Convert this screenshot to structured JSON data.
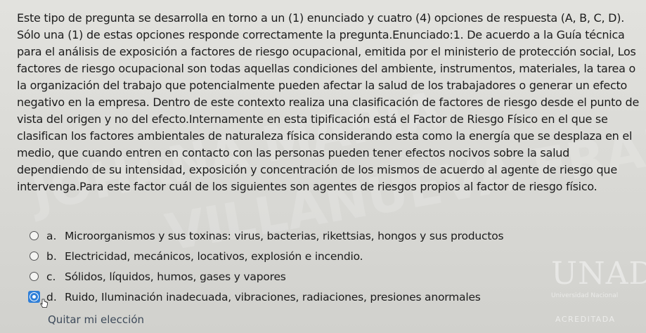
{
  "question": {
    "text": "Este tipo de pregunta se desarrolla en torno a un (1) enunciado y cuatro (4) opciones de respuesta (A, B, C, D). Sólo una (1) de estas opciones responde correctamente la pregunta.Enunciado:1. De acuerdo a la Guía técnica para el análisis de exposición a factores de riesgo ocupacional, emitida por el ministerio de protección social, Los factores de riesgo ocupacional son todas aquellas condiciones del ambiente, instrumentos, materiales, la tarea o la organización del trabajo que potencialmente pueden afectar la salud de los trabajadores o generar un efecto negativo en la empresa. Dentro de este contexto realiza una clasificación de factores de riesgo desde el punto de vista del origen y no del efecto.Internamente en esta tipificación está el Factor de Riesgo Físico en el que se clasifican los factores ambientales de naturaleza física considerando esta como la energía que se desplaza en el medio, que cuando entren en contacto con las personas pueden tener efectos nocivos sobre la salud dependiendo de su intensidad, exposición y concentración de los mismos de acuerdo al agente de riesgo que intervenga.Para este factor cuál de los siguientes son agentes de riesgos propios al factor de riesgo físico."
  },
  "options": [
    {
      "letter": "a.",
      "text": "Microorganismos y sus toxinas: virus, bacterias, rikettsias, hongos y sus productos",
      "selected": false
    },
    {
      "letter": "b.",
      "text": "Electricidad, mecánicos, locativos, explosión e incendio.",
      "selected": false
    },
    {
      "letter": "c.",
      "text": "Sólidos, líquidos, humos, gases y vapores",
      "selected": false
    },
    {
      "letter": "d.",
      "text": "Ruido, Iluminación inadecuada, vibraciones, radiaciones, presiones anormales",
      "selected": true
    }
  ],
  "clear_choice_label": "Quitar mi elección",
  "watermark": {
    "line1": "JOHANA MARIA",
    "line2": "VILLANUEVA FRANCO"
  },
  "logo": {
    "mark": "UNAD",
    "sub": "Universidad Nacional",
    "accredited": "ACREDITADA"
  },
  "colors": {
    "accent": "#1f6fd1",
    "background": "#d9d9d5",
    "text": "#1c1c1c"
  }
}
